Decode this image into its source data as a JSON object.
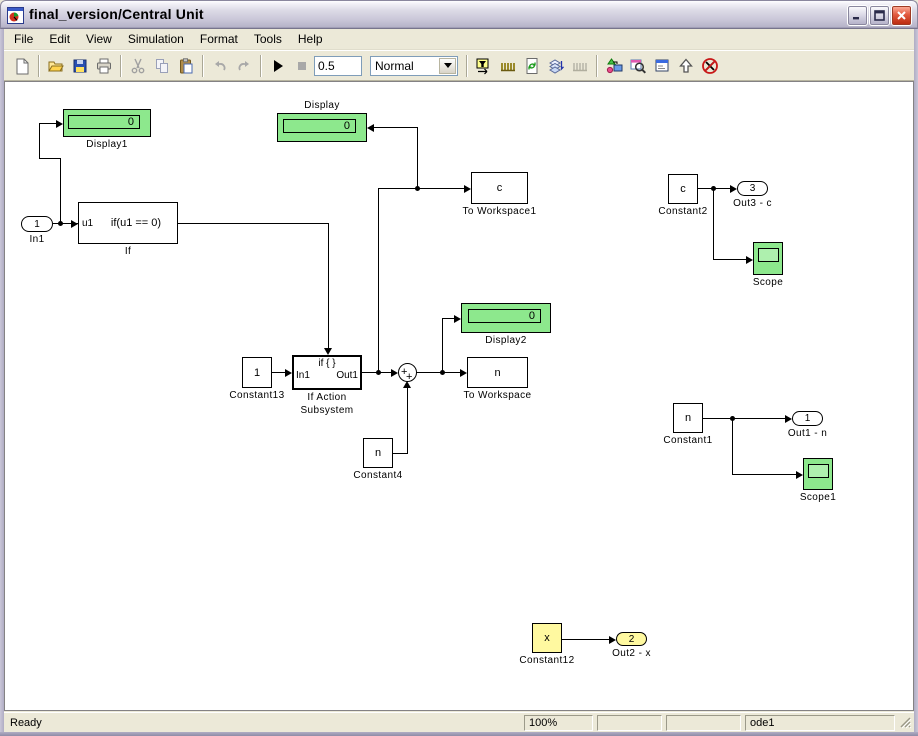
{
  "window": {
    "title": "final_version/Central Unit",
    "controls": {
      "minimize": "minimize",
      "maximize": "maximize",
      "close": "close"
    }
  },
  "menu": {
    "items": [
      "File",
      "Edit",
      "View",
      "Simulation",
      "Format",
      "Tools",
      "Help"
    ]
  },
  "toolbar": {
    "sim_stop_time": "0.5",
    "sim_mode": "Normal",
    "icons": [
      {
        "name": "new-model",
        "enabled": true
      },
      {
        "name": "open-model",
        "enabled": true
      },
      {
        "name": "save-model",
        "enabled": true
      },
      {
        "name": "print",
        "enabled": true
      },
      {
        "name": "cut",
        "enabled": false
      },
      {
        "name": "copy",
        "enabled": false
      },
      {
        "name": "paste",
        "enabled": true
      },
      {
        "name": "undo",
        "enabled": false
      },
      {
        "name": "redo",
        "enabled": false
      },
      {
        "name": "start-simulation",
        "enabled": true
      },
      {
        "name": "stop-simulation",
        "enabled": false
      },
      {
        "name": "model-browser",
        "enabled": true
      },
      {
        "name": "toggle-browser",
        "enabled": true
      },
      {
        "name": "update-diagram",
        "enabled": true
      },
      {
        "name": "build-all",
        "enabled": true
      },
      {
        "name": "incremental-build",
        "enabled": false
      },
      {
        "name": "library-browser",
        "enabled": true
      },
      {
        "name": "find",
        "enabled": true
      },
      {
        "name": "debugger",
        "enabled": true
      },
      {
        "name": "go-to-parent",
        "enabled": true
      },
      {
        "name": "remove-highlighting",
        "enabled": true
      }
    ]
  },
  "status": {
    "message": "Ready",
    "zoom": "100%",
    "panel2": "",
    "panel3": "",
    "solver": "ode1"
  },
  "colors": {
    "block_green": "#8DE88D",
    "block_yellow": "#FFF9A0",
    "titlebar_silver": "#C9C6D8",
    "close_red": "#C03014"
  },
  "blocks": {
    "display1": {
      "label": "Display1",
      "value": "0"
    },
    "in1": {
      "label": "In1",
      "value": "1"
    },
    "if": {
      "label": "If",
      "in_port": "u1",
      "expr": "if(u1 == 0)"
    },
    "display": {
      "label": "Display",
      "value": "0"
    },
    "to_workspace1": {
      "label": "To Workspace1",
      "value": "c"
    },
    "constant2": {
      "label": "Constant2",
      "value": "c"
    },
    "out3": {
      "label": "Out3 - c",
      "value": "3"
    },
    "scope": {
      "label": "Scope"
    },
    "constant13": {
      "label": "Constant13",
      "value": "1"
    },
    "if_action": {
      "label_line1": "If Action",
      "label_line2": "Subsystem",
      "action_port": "if { }",
      "in_port": "In1",
      "out_port": "Out1"
    },
    "sum": {
      "sign1": "+",
      "sign2": "+"
    },
    "display2": {
      "label": "Display2",
      "value": "0"
    },
    "to_workspace": {
      "label": "To Workspace",
      "value": "n"
    },
    "constant4": {
      "label": "Constant4",
      "value": "n"
    },
    "constant1": {
      "label": "Constant1",
      "value": "n"
    },
    "out1": {
      "label": "Out1 - n",
      "value": "1"
    },
    "scope1": {
      "label": "Scope1"
    },
    "constant12": {
      "label": "Constant12",
      "value": "x"
    },
    "out2": {
      "label": "Out2 - x",
      "value": "2"
    }
  }
}
